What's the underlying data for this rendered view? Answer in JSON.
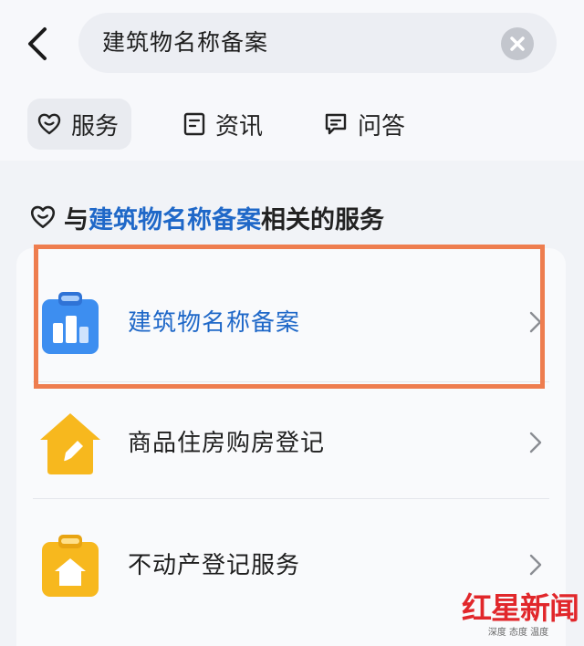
{
  "search": {
    "query": "建筑物名称备案"
  },
  "tabs": [
    {
      "label": "服务",
      "icon": "heart-outline-icon",
      "active": true
    },
    {
      "label": "资讯",
      "icon": "news-icon",
      "active": false
    },
    {
      "label": "问答",
      "icon": "chat-bubble-icon",
      "active": false
    }
  ],
  "section": {
    "prefix": "与",
    "keyword": "建筑物名称备案",
    "suffix": "相关的服务"
  },
  "services": [
    {
      "label": "建筑物名称备案",
      "icon": "blue-clipboard-building-icon",
      "color": "#3d8ef0",
      "highlighted": true
    },
    {
      "label": "商品住房购房登记",
      "icon": "yellow-house-pen-icon",
      "color": "#f7b81e",
      "highlighted": false
    },
    {
      "label": "不动产登记服务",
      "icon": "yellow-clipboard-house-icon",
      "color": "#f7b81e",
      "highlighted": false
    }
  ],
  "watermark": {
    "title": "红星新闻",
    "subtitle": "深度 态度 温度"
  },
  "colors": {
    "accent": "#1f68c8",
    "highlight_border": "#ee7d4f"
  }
}
